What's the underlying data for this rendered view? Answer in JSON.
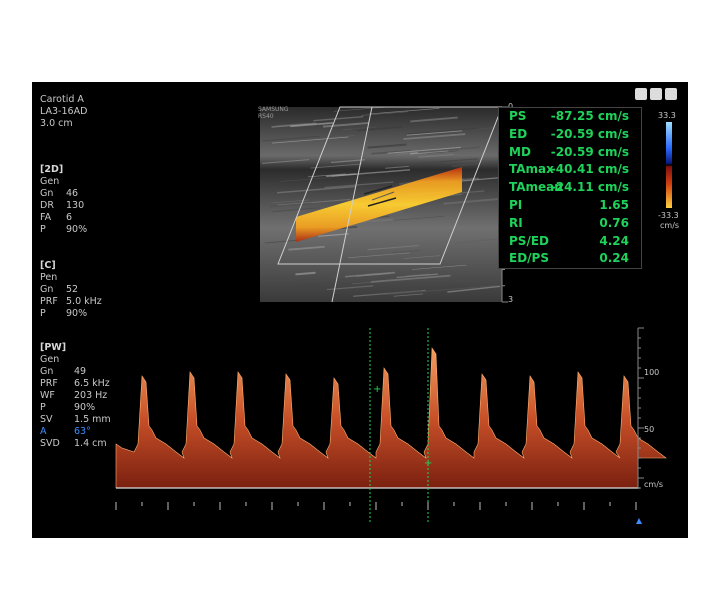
{
  "header": {
    "preset": "Carotid A",
    "probe": "LA3-16AD",
    "depth": "3.0 cm"
  },
  "params_2d": {
    "title": "[2D]",
    "mode": "Gen",
    "rows": [
      {
        "k": "Gn",
        "v": "46"
      },
      {
        "k": "DR",
        "v": "130"
      },
      {
        "k": "FA",
        "v": "6"
      },
      {
        "k": "P",
        "v": "90%"
      }
    ]
  },
  "params_color": {
    "title": "[C]",
    "mode": "Pen",
    "rows": [
      {
        "k": "Gn",
        "v": "52"
      },
      {
        "k": "PRF",
        "v": "5.0 kHz"
      },
      {
        "k": "P",
        "v": "90%"
      }
    ]
  },
  "params_pw": {
    "title": "[PW]",
    "mode": "Gen",
    "rows": [
      {
        "k": "Gn",
        "v": "49"
      },
      {
        "k": "PRF",
        "v": "6.5 kHz"
      },
      {
        "k": "WF",
        "v": "203 Hz"
      },
      {
        "k": "P",
        "v": "90%"
      },
      {
        "k": "SV",
        "v": "1.5 mm"
      },
      {
        "k": "A",
        "v": "63°"
      },
      {
        "k": "SVD",
        "v": "1.4 cm"
      }
    ]
  },
  "measurements": [
    {
      "label": "PS",
      "value": "-87.25 cm/s"
    },
    {
      "label": "ED",
      "value": "-20.59 cm/s"
    },
    {
      "label": "MD",
      "value": "-20.59 cm/s"
    },
    {
      "label": "TAmax",
      "value": "-40.41 cm/s"
    },
    {
      "label": "TAmean",
      "value": "-24.11 cm/s"
    },
    {
      "label": "PI",
      "value": "1.65"
    },
    {
      "label": "RI",
      "value": "0.76"
    },
    {
      "label": "PS/ED",
      "value": "4.24"
    },
    {
      "label": "ED/PS",
      "value": "0.24"
    }
  ],
  "image_label": {
    "brand": "SAMSUNG",
    "model": "RS40"
  },
  "depth_scale": {
    "top": "0",
    "bottom": "3"
  },
  "color_bar": {
    "top": "33.3",
    "bottom": "-33.3",
    "unit": "cm/s"
  },
  "spectrum_scale": {
    "labels": [
      "100",
      "50"
    ],
    "unit": "cm/s"
  },
  "colors": {
    "measure_text": "#1fd25a",
    "accent_blue": "#3c8cff",
    "spectrum": "#e0703a"
  }
}
